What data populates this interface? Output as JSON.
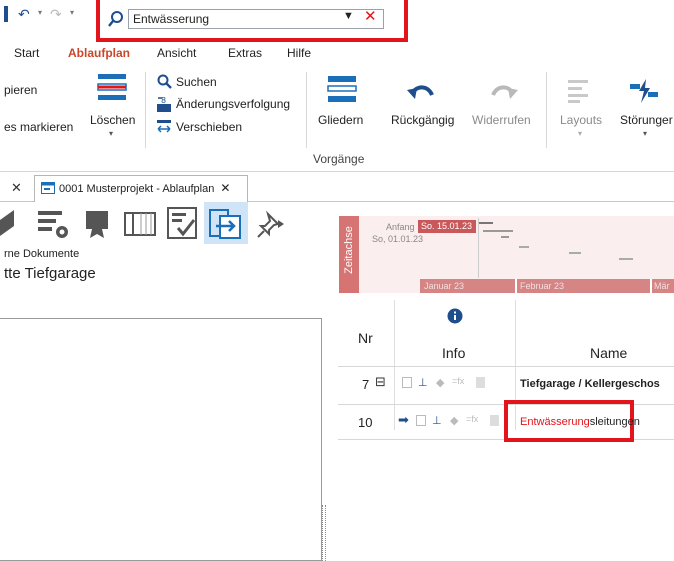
{
  "search": {
    "value": "Entwässerung"
  },
  "menu": [
    "Start",
    "Ablaufplan",
    "Ansicht",
    "Extras",
    "Hilfe"
  ],
  "ribbon": {
    "kopieren": "pieren",
    "markieren": "es markieren",
    "loeschen": "Löschen",
    "suchen": "Suchen",
    "aenderung": "Änderungsverfolgung",
    "verschieben": "Verschieben",
    "gliedern": "Gliedern",
    "rueckgaengig": "Rückgängig",
    "widerrufen": "Widerrufen",
    "layouts": "Layouts",
    "stoerungen": "Störunger",
    "group": "Vorgänge"
  },
  "tab": {
    "title": "0001 Musterprojekt - Ablaufplan"
  },
  "left": {
    "docs": "rne Dokumente",
    "title": "tte Tiefgarage"
  },
  "timeline": {
    "label": "Zeitachse",
    "anfang": "Anfang",
    "start_date": "So. 15.01.23",
    "so_date": "So, 01.01.23",
    "januar": "Januar 23",
    "februar": "Februar 23",
    "maerz": "Mär"
  },
  "table": {
    "col_nr": "Nr",
    "col_info": "Info",
    "col_name": "Name",
    "rows": [
      {
        "nr": "7",
        "name": "Tiefgarage / Kellergeschos"
      },
      {
        "nr": "10",
        "name_hl": "Entwässerung",
        "name_rest": "sleitungen"
      }
    ]
  }
}
